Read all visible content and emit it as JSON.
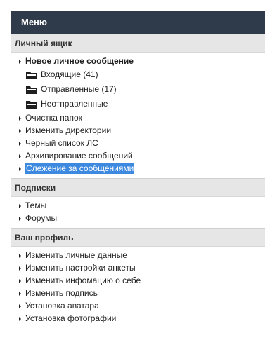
{
  "header": {
    "title": "Меню"
  },
  "sections": [
    {
      "title": "Личный ящик",
      "primary": "Новое личное сообщение",
      "folders": [
        "Входящие (41)",
        "Отправленные (17)",
        "Неотправленные"
      ],
      "items": [
        "Очистка папок",
        "Изменить директории",
        "Черный список ЛС",
        "Архивирование сообщений",
        "Слежение за сообщениями"
      ]
    },
    {
      "title": "Подписки",
      "items": [
        "Темы",
        "Форумы"
      ]
    },
    {
      "title": "Ваш профиль",
      "items": [
        "Изменить личные данные",
        "Изменить настройки анкеты",
        "Изменить инфомацию о себе",
        "Изменить подпись",
        "Установка аватара",
        "Установка фотографии"
      ]
    }
  ],
  "colors": {
    "header_bg": "#2f3b4b",
    "section_bg": "#e6e6e6",
    "selection": "#3d89e0"
  },
  "icons": {
    "bullet": "triangle-right-icon",
    "folder": "folder-icon"
  }
}
